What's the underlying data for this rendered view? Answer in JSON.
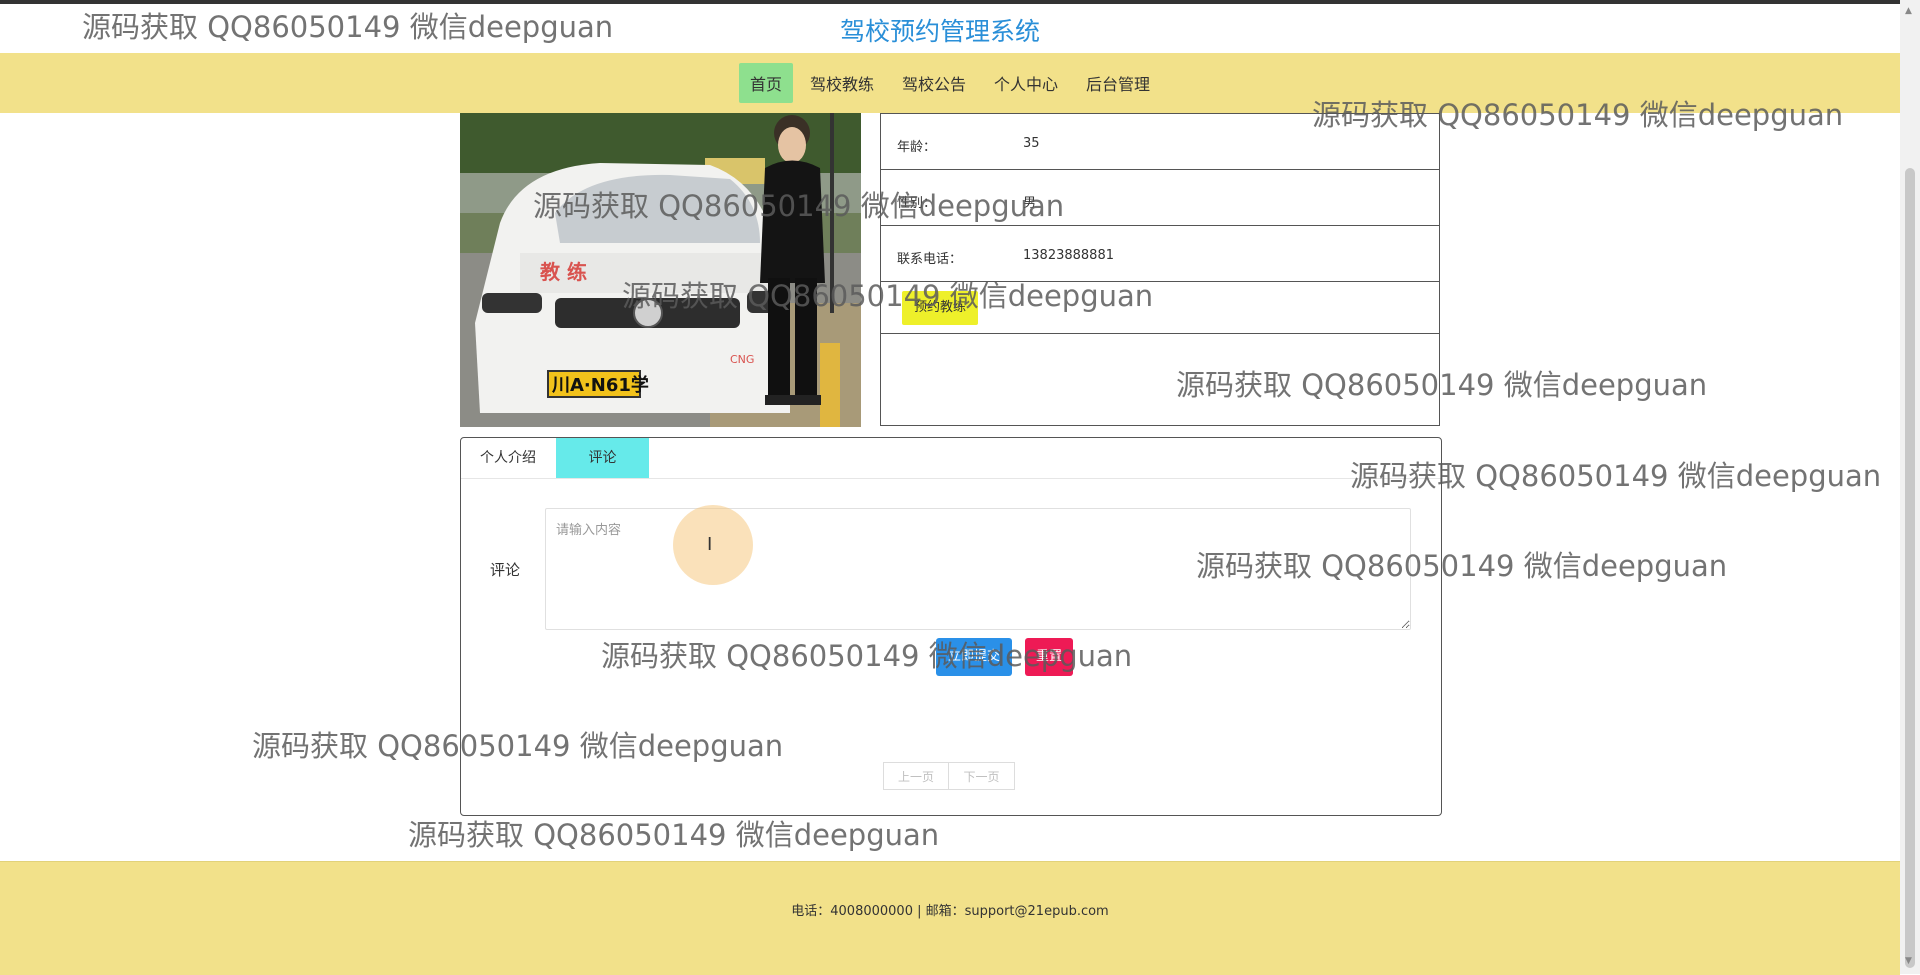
{
  "header": {
    "title": "驾校预约管理系统"
  },
  "nav": {
    "items": [
      "首页",
      "驾校教练",
      "驾校公告",
      "个人中心",
      "后台管理"
    ],
    "active_index": 0
  },
  "coach": {
    "fields": [
      {
        "label": "年龄：",
        "value": "35"
      },
      {
        "label": "性别：",
        "value": "男"
      },
      {
        "label": "联系电话：",
        "value": "13823888881"
      }
    ],
    "book_button": "预约教练",
    "photo_plate": "川A·N61学",
    "photo_logo": "教 练",
    "photo_cng": "CNG"
  },
  "tabs": [
    "个人介绍",
    "评论"
  ],
  "active_tab": 1,
  "comment": {
    "label": "评论",
    "placeholder": "请输入内容",
    "submit": "立即提交",
    "reset": "重置"
  },
  "pager": {
    "prev": "上一页",
    "next": "下一页"
  },
  "footer": {
    "text": "电话：4008000000 | 邮箱：support@21epub.com"
  },
  "watermark": "源码获取 QQ86050149 微信deepguan",
  "colors": {
    "nav_bg": "#f2e18a",
    "active_nav": "#8ee08e",
    "title": "#2a8fd8",
    "book_button": "#eef02a",
    "active_tab": "#66eaea",
    "submit": "#2a90e8",
    "reset": "#ee1a55"
  }
}
